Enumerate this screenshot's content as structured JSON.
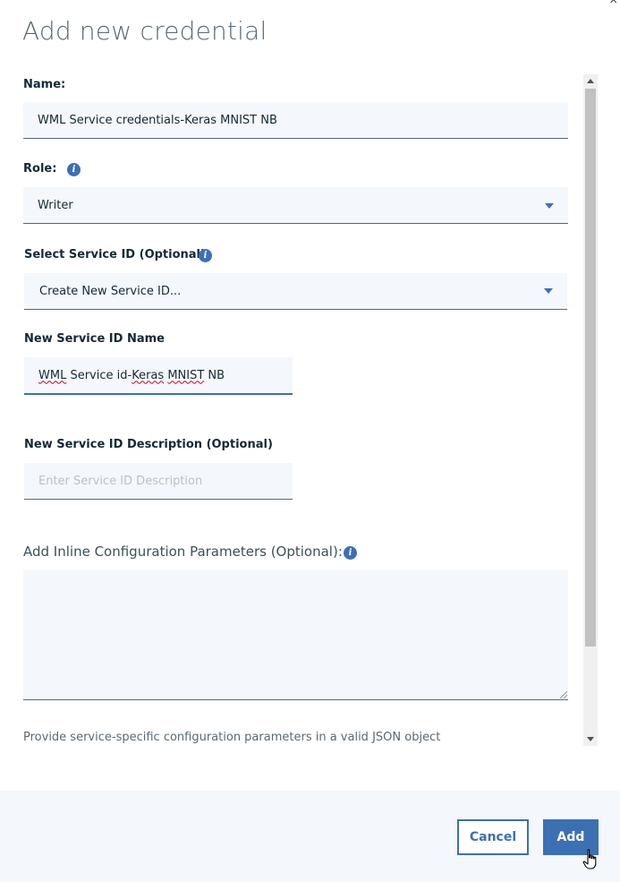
{
  "dialog": {
    "title": "Add new credential",
    "close_glyph": "×"
  },
  "form": {
    "name": {
      "label": "Name:",
      "value": "WML Service credentials-Keras MNIST NB"
    },
    "role": {
      "label": "Role:",
      "selected": "Writer"
    },
    "service_id": {
      "label": "Select Service ID (Optional)",
      "selected": "Create New Service ID..."
    },
    "new_service_id_name": {
      "label": "New Service ID Name",
      "value_parts": [
        "WML",
        " Service id-",
        "Keras",
        " ",
        "MNIST",
        " NB"
      ]
    },
    "new_service_id_description": {
      "label": "New Service ID Description (Optional)",
      "placeholder": "Enter Service ID Description"
    },
    "inline_params": {
      "label": "Add Inline Configuration Parameters (Optional):",
      "value": "",
      "helper": "Provide service-specific configuration parameters in a valid JSON object"
    }
  },
  "icons": {
    "info": "i"
  },
  "footer": {
    "cancel_label": "Cancel",
    "add_label": "Add"
  },
  "colors": {
    "accent": "#3d70b2",
    "field_bg": "#f4f7fb",
    "footer_bg": "#f4f7fb"
  }
}
